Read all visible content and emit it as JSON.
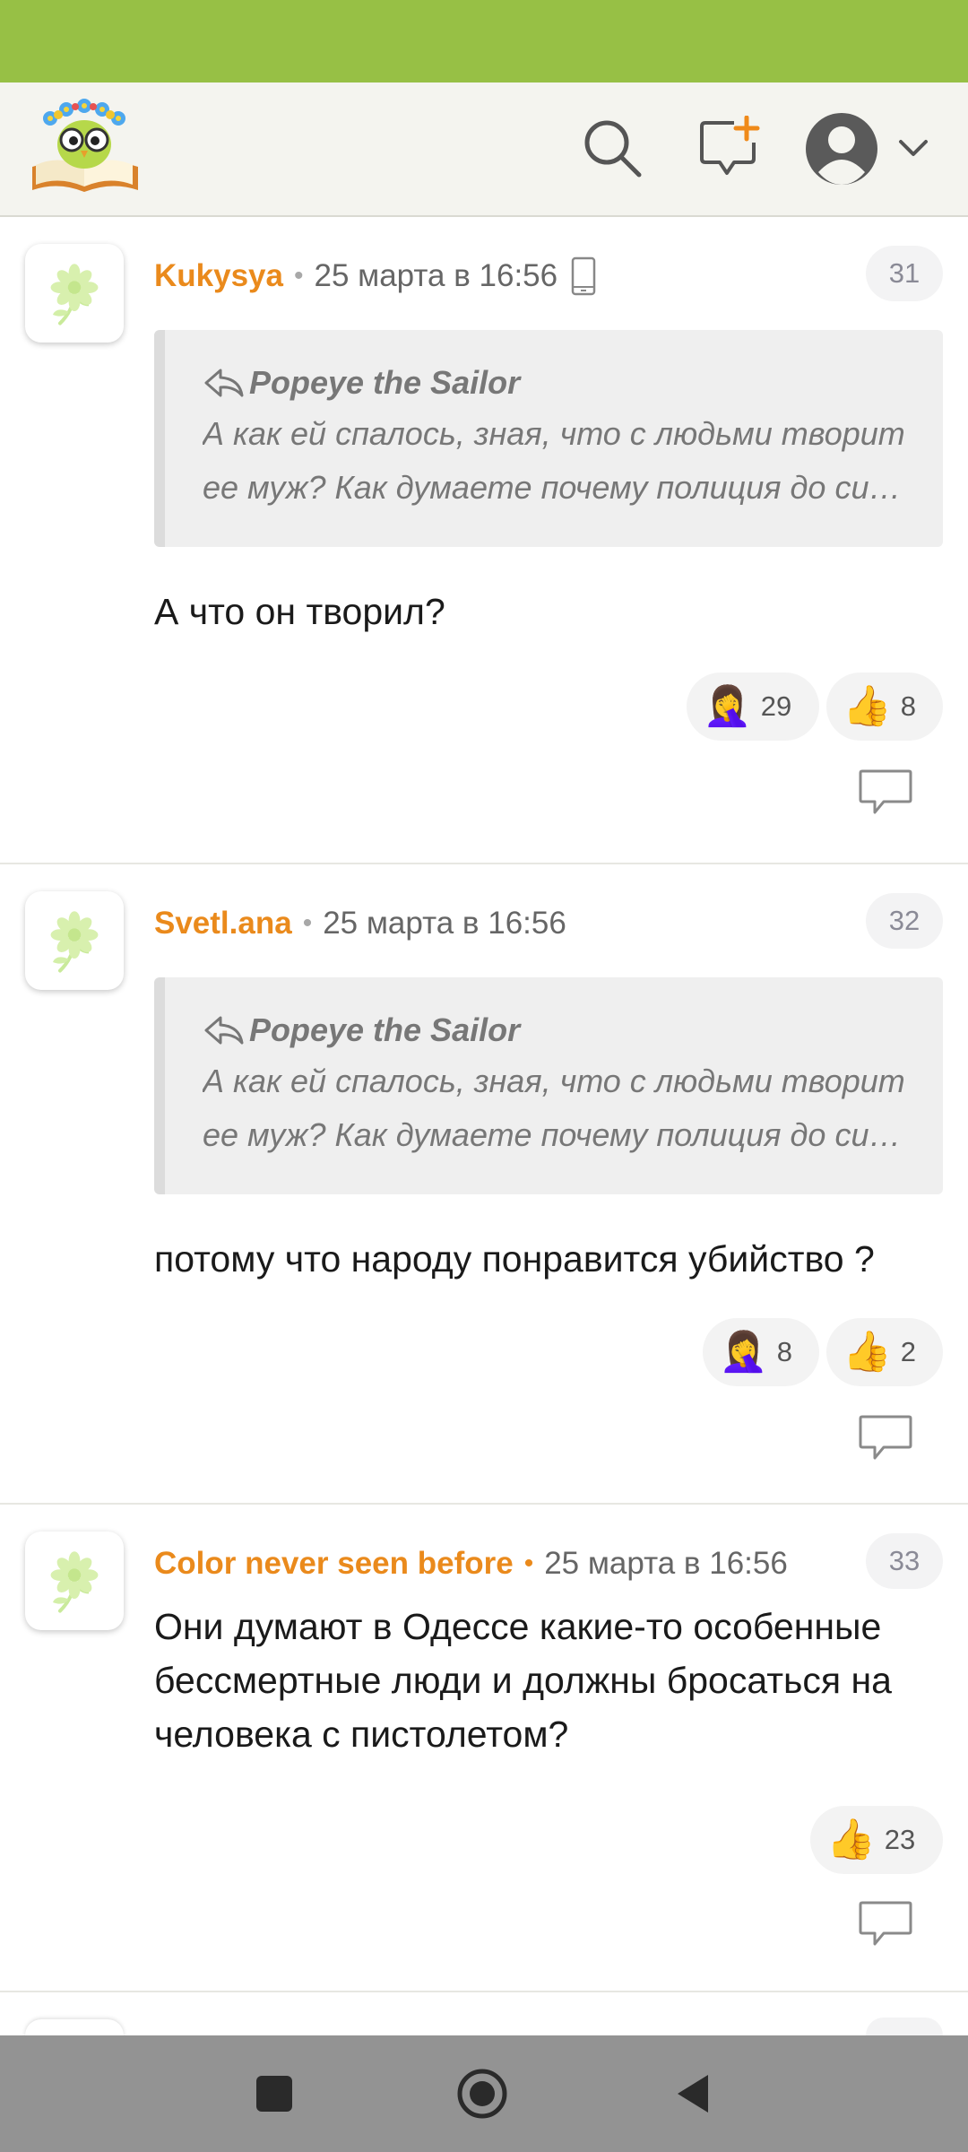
{
  "header": {
    "logo_icon": "owl-on-book-logo",
    "search_icon": "search-icon",
    "new_post_icon": "new-post-icon",
    "profile_icon": "user-avatar-icon"
  },
  "comments": [
    {
      "author": "Kukysya",
      "date": "25 марта в 16:56",
      "device": "mobile-phone-icon",
      "number": "31",
      "quote": {
        "author": "Popeye the Sailor",
        "text": "А как ей спалось, зная, что с людьми творит ее муж? Как думаете почему полиция до сих пор не нашла?"
      },
      "text": "А что он творил?",
      "reactions": [
        {
          "emoji": "🤦‍♀️",
          "count": "29"
        },
        {
          "emoji": "👍",
          "count": "8"
        }
      ]
    },
    {
      "author": "Svetl.ana",
      "date": "25 марта в 16:56",
      "number": "32",
      "quote": {
        "author": "Popeye the Sailor",
        "text": "А как ей спалось, зная, что с людьми творит ее муж? Как думаете почему полиция до сих пор не нашла?"
      },
      "text": "потому что народу понравится убийство ?",
      "reactions": [
        {
          "emoji": "🤦‍♀️",
          "count": "8"
        },
        {
          "emoji": "👍",
          "count": "2"
        }
      ]
    },
    {
      "author": "Color never seen before",
      "date": "25 марта в 16:56",
      "number": "33",
      "text": "Они думают в Одессе какие-то особенные бессмертные люди и должны бросаться на человека с пистолетом?",
      "reactions": [
        {
          "emoji": "👍",
          "count": "23"
        }
      ]
    }
  ],
  "colors": {
    "status_bar": "#97c045",
    "author": "#ea8a1c",
    "nav_bar": "#939393"
  },
  "nav": {
    "recents_icon": "square-icon",
    "home_icon": "circle-icon",
    "back_icon": "triangle-back-icon"
  }
}
